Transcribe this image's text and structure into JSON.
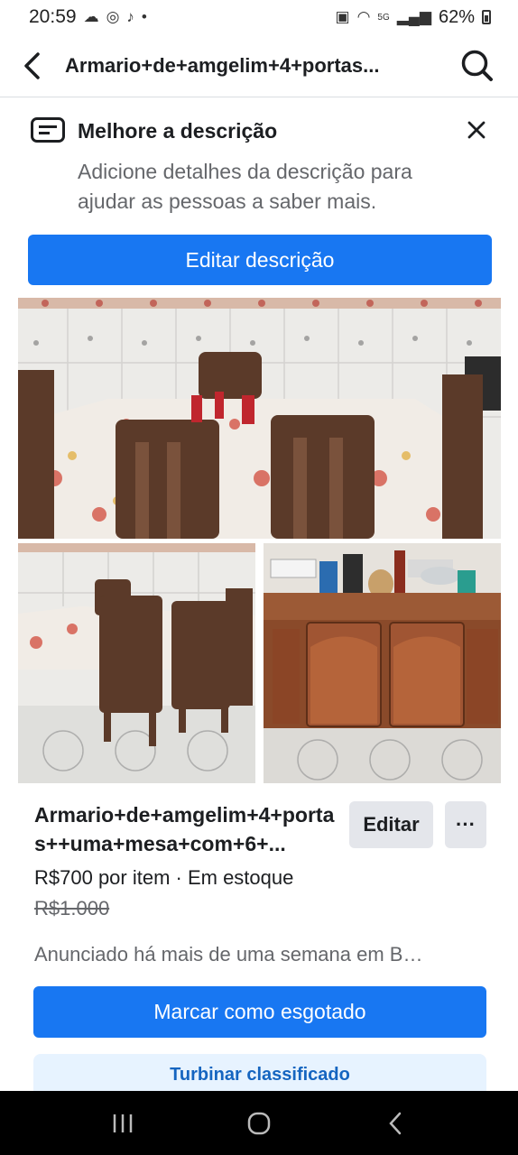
{
  "status_bar": {
    "time": "20:59",
    "battery": "62%",
    "network": "5G"
  },
  "header": {
    "title": "Armario+de+amgelim+4+portas..."
  },
  "tip": {
    "title": "Melhore a descrição",
    "description": "Adicione detalhes da descrição para ajudar as pessoas a saber mais.",
    "button_label": "Editar descrição"
  },
  "listing": {
    "title": "Armario+de+amgelim+4+portas++uma+mesa+com+6+...",
    "edit_label": "Editar",
    "more_label": "···",
    "price_line": "R$700 por item · Em estoque",
    "old_price": "R$1.000",
    "listed_line": "Anunciado há mais de uma semana em B…",
    "mark_sold_label": "Marcar como esgotado",
    "boost_label": "Turbinar classificado"
  },
  "colors": {
    "accent": "#1877f2",
    "secondary_bg": "#e4e6eb",
    "muted_text": "#65676b",
    "boost_bg": "#e7f3ff"
  }
}
